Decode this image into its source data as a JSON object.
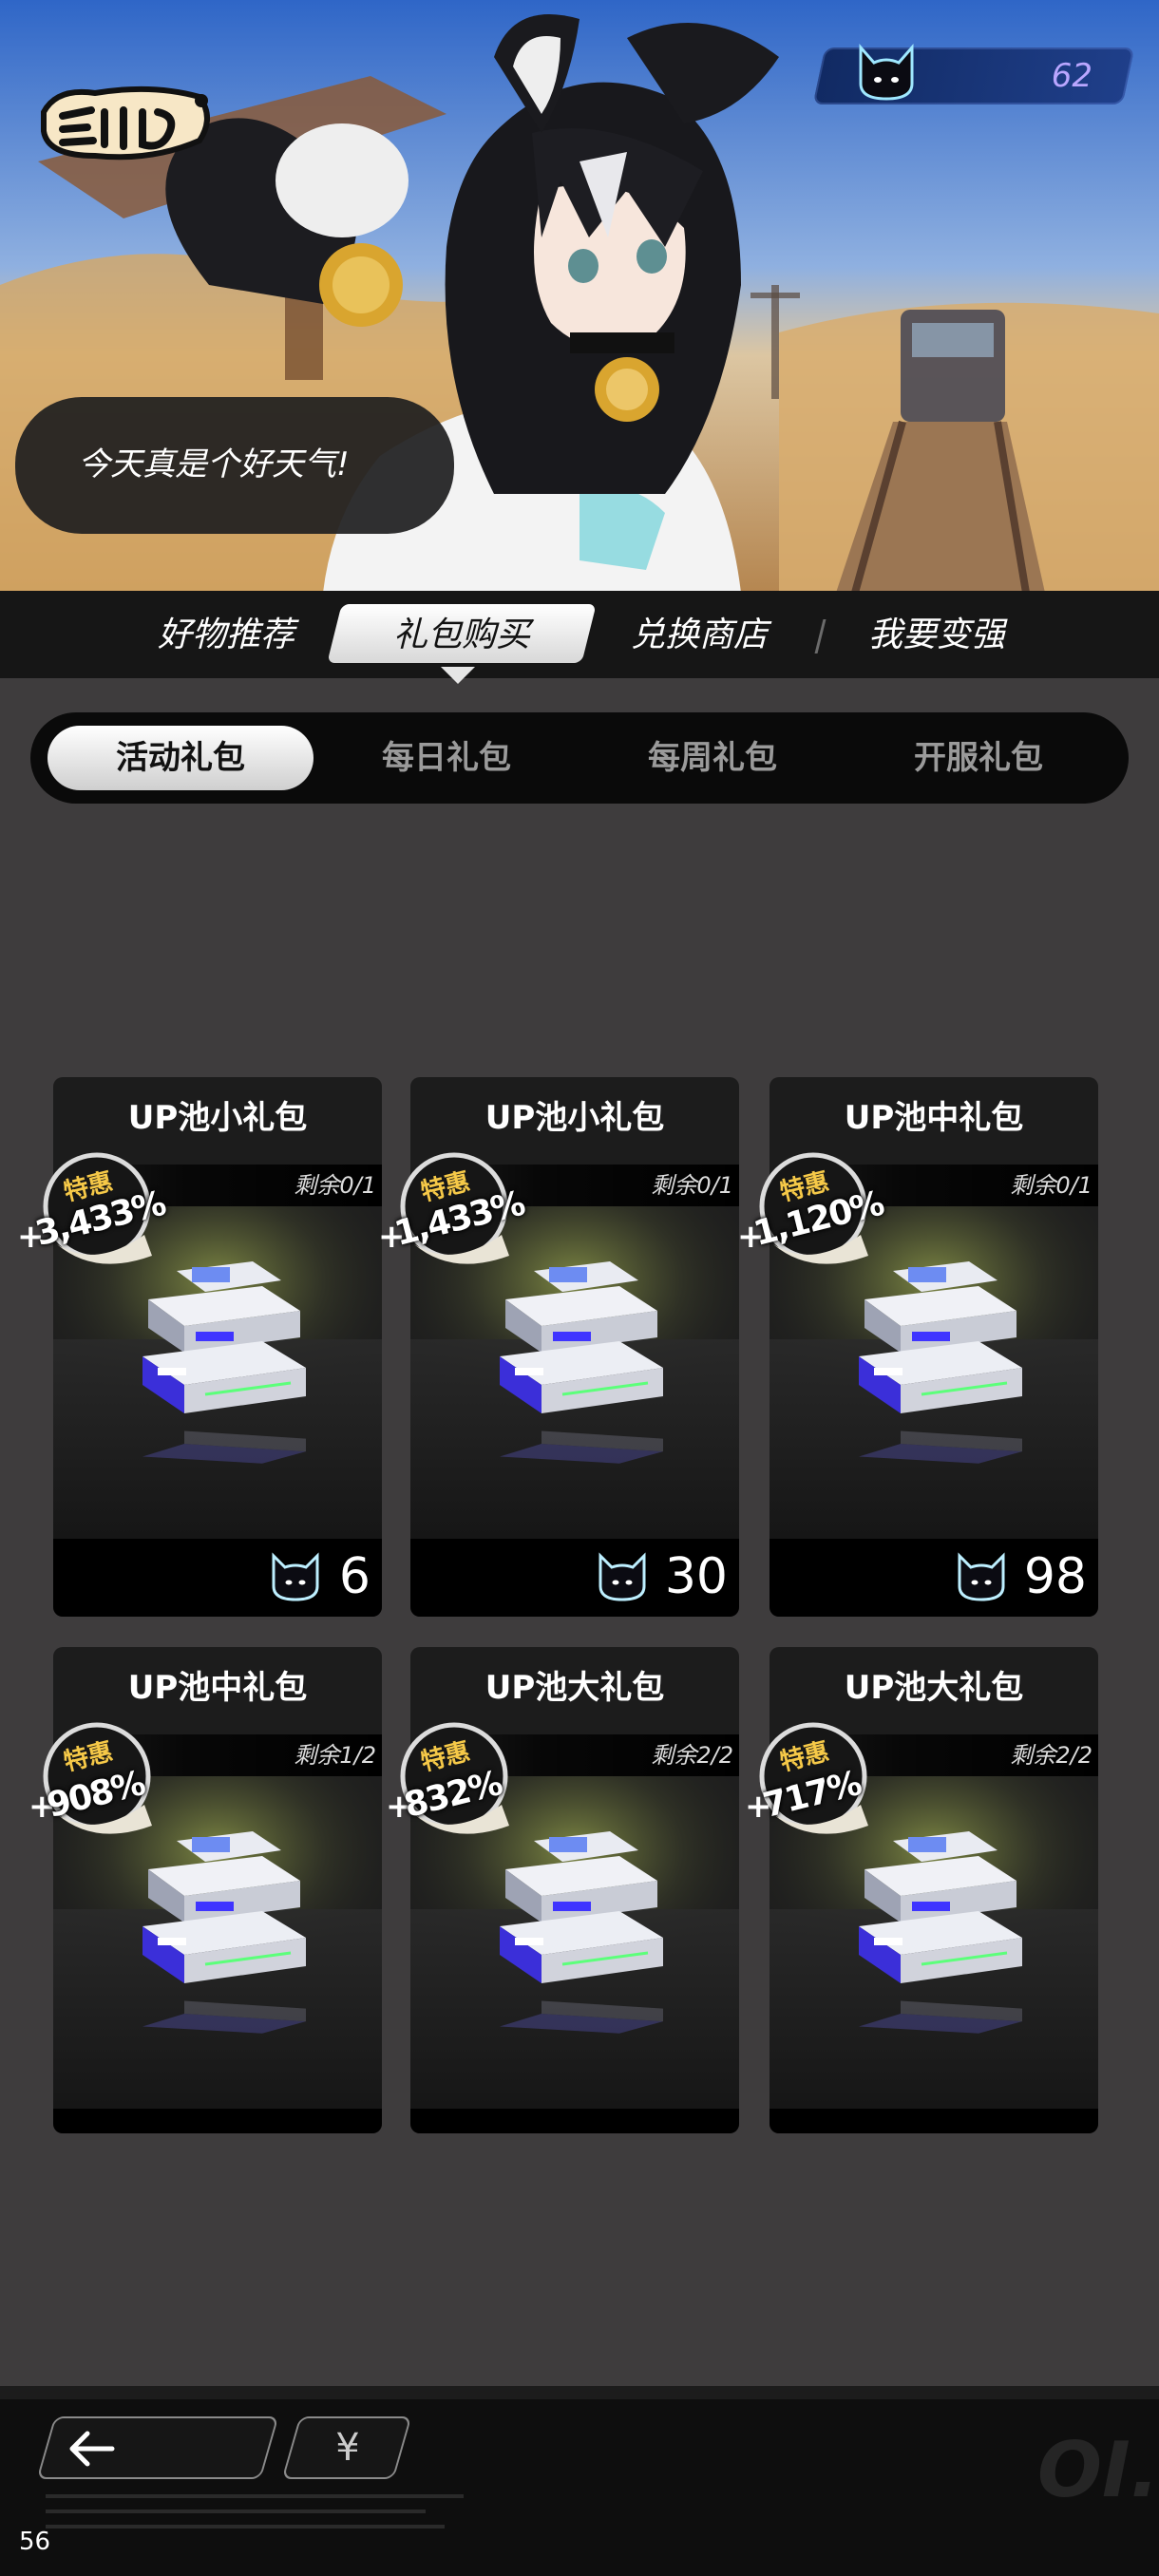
{
  "hero": {
    "speech": "今天真是个好天气!",
    "currency_icon": "cat-head-icon",
    "currency_value": "62"
  },
  "main_nav": {
    "items": [
      "好物推荐",
      "礼包购买",
      "兑换商店",
      "我要变强"
    ],
    "active_index": 1
  },
  "sub_tabs": {
    "items": [
      "活动礼包",
      "每日礼包",
      "每周礼包",
      "开服礼包"
    ],
    "active_index": 0
  },
  "cards": [
    {
      "title": "UP池小礼包",
      "remaining": "剩余0/1",
      "badge_label": "特惠",
      "badge_plus": "+",
      "badge_percent": "3,433%",
      "price_icon": "cat-head-icon",
      "price": "6"
    },
    {
      "title": "UP池小礼包",
      "remaining": "剩余0/1",
      "badge_label": "特惠",
      "badge_plus": "+",
      "badge_percent": "1,433%",
      "price_icon": "cat-head-icon",
      "price": "30"
    },
    {
      "title": "UP池中礼包",
      "remaining": "剩余0/1",
      "badge_label": "特惠",
      "badge_plus": "+",
      "badge_percent": "1,120%",
      "price_icon": "cat-head-icon",
      "price": "98"
    },
    {
      "title": "UP池中礼包",
      "remaining": "剩余1/2",
      "badge_label": "特惠",
      "badge_plus": "+",
      "badge_percent": "908%"
    },
    {
      "title": "UP池大礼包",
      "remaining": "剩余2/2",
      "badge_label": "特惠",
      "badge_plus": "+",
      "badge_percent": "832%"
    },
    {
      "title": "UP池大礼包",
      "remaining": "剩余2/2",
      "badge_label": "特惠",
      "badge_plus": "+",
      "badge_percent": "717%"
    }
  ],
  "bottom_bar": {
    "back_icon": "arrow-left-icon",
    "yen_label": "¥",
    "watermark": "OI."
  },
  "fps": "56",
  "colors": {
    "page_bg": "#3e3c3d",
    "nav_bg": "#161616",
    "badge_gold": "#f6c948",
    "currency_purple": "#b9a6ff",
    "gift_box_blue": "#4a3cf0"
  }
}
